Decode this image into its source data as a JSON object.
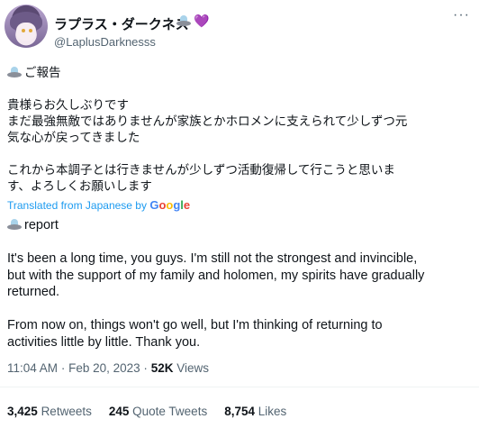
{
  "author": {
    "display_name": "ラプラス・ダークネス",
    "handle": "@LaplusDarknesss",
    "badge_icons": [
      "ufo-icon",
      "purple-heart-icon"
    ],
    "heart_glyph": "💜"
  },
  "tweet_ja": {
    "heading": "ご報告",
    "lines": [
      "貴様らお久しぶりです",
      "まだ最強無敵ではありませんが家族とかホロメンに支えられて少しずつ元",
      "気な心が戻ってきました",
      "",
      "これから本調子とは行きませんが少しずつ活動復帰して行こうと思いま",
      "す、よろしくお願いします"
    ]
  },
  "translation": {
    "label": "Translated from Japanese by",
    "provider_letters": [
      "G",
      "o",
      "o",
      "g",
      "l",
      "e"
    ]
  },
  "tweet_en": {
    "heading": "report",
    "lines": [
      "It's been a long time, you guys. I'm still not the strongest and invincible,",
      "but with the support of my family and holomen, my spirits have gradually",
      "returned.",
      "",
      "From now on, things won't go well, but I'm thinking of returning to",
      "activities little by little. Thank you."
    ]
  },
  "meta": {
    "time": "11:04 AM",
    "sep": "·",
    "date": "Feb 20, 2023",
    "views_count": "52K",
    "views_label": "Views"
  },
  "stats": {
    "retweets_count": "3,425",
    "retweets_label": "Retweets",
    "quotes_count": "245",
    "quotes_label": "Quote Tweets",
    "likes_count": "8,754",
    "likes_label": "Likes"
  },
  "more_glyph": "···",
  "colors": {
    "link_blue": "#1d9bf0",
    "secondary_text": "#536471",
    "primary_text": "#0f1419",
    "divider": "#eff3f4"
  }
}
